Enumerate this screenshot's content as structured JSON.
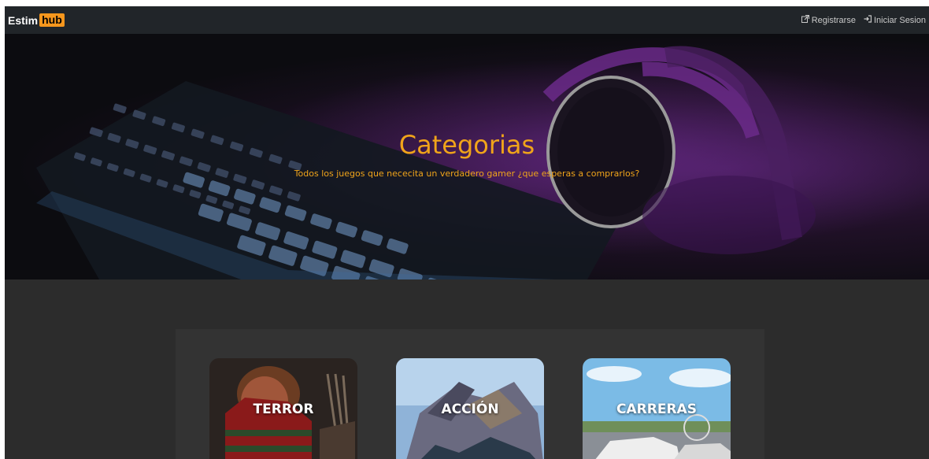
{
  "navbar": {
    "brand_text": "Estim",
    "brand_highlight": "hub",
    "register_label": "Registrarse",
    "login_label": "Iniciar Sesion",
    "register_icon": "external-link-icon",
    "login_icon": "sign-in-icon"
  },
  "hero": {
    "title": "Categorias",
    "subtitle": "Todos los juegos que nececita un verdadero gamer ¿que esperas a comprarlos?"
  },
  "categories": [
    {
      "label": "TERROR"
    },
    {
      "label": "ACCIÓN"
    },
    {
      "label": "CARRERAS"
    }
  ],
  "colors": {
    "accent": "#f0a41a",
    "brand_badge": "#f7971d",
    "navbar_bg": "#212529",
    "page_bg": "#2c2c2c",
    "panel_bg": "#333333"
  }
}
